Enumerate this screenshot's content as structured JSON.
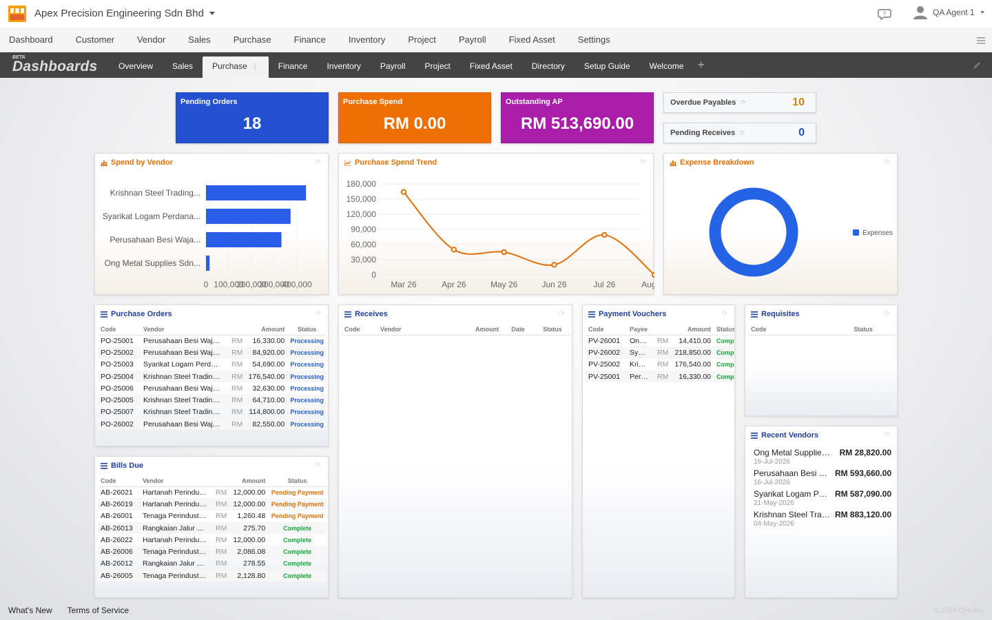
{
  "company": "Apex Precision Engineering Sdn Bhd",
  "user": "QA Agent 1",
  "main_nav": [
    "Dashboard",
    "Customer",
    "Vendor",
    "Sales",
    "Purchase",
    "Finance",
    "Inventory",
    "Project",
    "Payroll",
    "Fixed Asset",
    "Settings"
  ],
  "dashboard": {
    "beta": "BETA",
    "title": "Dashboards",
    "tabs": [
      "Overview",
      "Sales",
      "Purchase",
      "Finance",
      "Inventory",
      "Payroll",
      "Project",
      "Fixed Asset",
      "Directory",
      "Setup Guide",
      "Welcome"
    ],
    "active_tab": "Purchase",
    "add": "+"
  },
  "kpis": {
    "pending_orders": {
      "label": "Pending Orders",
      "value": "18",
      "color": "#2250cf"
    },
    "purchase_spend": {
      "label": "Purchase Spend",
      "value": "RM 0.00",
      "color": "#ee7004"
    },
    "outstanding_ap": {
      "label": "Outstanding AP",
      "value": "RM 513,690.00",
      "color": "#a81ea8"
    },
    "overdue_payables": {
      "label": "Overdue Payables",
      "value": "10",
      "color": "#c98a00"
    },
    "pending_receives": {
      "label": "Pending Receives",
      "value": "0",
      "color": "#2250cf"
    }
  },
  "panels": {
    "spend_by_vendor": "Spend by Vendor",
    "purchase_spend_trend": "Purchase Spend Trend",
    "expense_breakdown": "Expense Breakdown",
    "purchase_orders": "Purchase Orders",
    "receives": "Receives",
    "payment_vouchers": "Payment Vouchers",
    "requisites": "Requisites",
    "bills_due": "Bills Due",
    "recent_vendors": "Recent Vendors"
  },
  "chart_data": [
    {
      "type": "bar",
      "orientation": "horizontal",
      "title": "Spend by Vendor",
      "categories": [
        "Krishnan Steel Trading...",
        "Syarikat Logam Perdana...",
        "Perusahaan Besi Waja...",
        "Ong Metal Supplies Sdn..."
      ],
      "values": [
        440000,
        372000,
        332000,
        16000
      ],
      "xticks": [
        "0",
        "100,000",
        "200,000",
        "300,000",
        "400,000"
      ],
      "xlim": [
        0,
        500000
      ]
    },
    {
      "type": "line",
      "title": "Purchase Spend Trend",
      "categories": [
        "Mar 26",
        "Apr 26",
        "May 26",
        "Jun 26",
        "Jul 26",
        "Aug 26"
      ],
      "values": [
        164000,
        50000,
        45000,
        20000,
        79000,
        0
      ],
      "yticks": [
        "180,000",
        "150,000",
        "120,000",
        "90,000",
        "60,000",
        "30,000",
        "0"
      ],
      "ylim": [
        0,
        180000
      ],
      "color": "#e07006"
    },
    {
      "type": "pie",
      "style": "donut",
      "title": "Expense Breakdown",
      "labels": [
        "Expenses"
      ],
      "values": [
        100
      ],
      "color": "#2563e6"
    }
  ],
  "purchase_orders": {
    "headers": [
      "Code",
      "Vendor",
      "Amount",
      "Status"
    ],
    "rows": [
      {
        "code": "PO-25001",
        "vendor": "Perusahaan Besi Waja Sdn Bhd",
        "rm": "RM",
        "amount": "16,330.00",
        "status": "Processing"
      },
      {
        "code": "PO-25002",
        "vendor": "Perusahaan Besi Waja Sdn Bhd",
        "rm": "RM",
        "amount": "84,920.00",
        "status": "Processing"
      },
      {
        "code": "PO-25003",
        "vendor": "Syarikat Logam Perdana Sdn Bhd",
        "rm": "RM",
        "amount": "54,690.00",
        "status": "Processing"
      },
      {
        "code": "PO-25004",
        "vendor": "Krishnan Steel Trading Sdn Bhd",
        "rm": "RM",
        "amount": "176,540.00",
        "status": "Processing"
      },
      {
        "code": "PO-25006",
        "vendor": "Perusahaan Besi Waja Sdn Bhd",
        "rm": "RM",
        "amount": "32,630.00",
        "status": "Processing"
      },
      {
        "code": "PO-25005",
        "vendor": "Krishnan Steel Trading Sdn Bhd",
        "rm": "RM",
        "amount": "64,710.00",
        "status": "Processing"
      },
      {
        "code": "PO-25007",
        "vendor": "Krishnan Steel Trading Sdn Bhd",
        "rm": "RM",
        "amount": "114,800.00",
        "status": "Processing"
      },
      {
        "code": "PO-26002",
        "vendor": "Perusahaan Besi Waja Sdn Bhd",
        "rm": "RM",
        "amount": "82,550.00",
        "status": "Processing"
      }
    ]
  },
  "receives": {
    "headers": [
      "Code",
      "Vendor",
      "Amount",
      "Date",
      "Status"
    ]
  },
  "payment_vouchers": {
    "headers": [
      "Code",
      "Payee",
      "Amount",
      "Status"
    ],
    "rows": [
      {
        "code": "PV-26001",
        "payee": "Ong Metal Supplies Sdn Bhd",
        "rm": "RM",
        "amount": "14,410.00",
        "status": "Complete"
      },
      {
        "code": "PV-26002",
        "payee": "Syarikat Logam Perdana Sdn Bhd",
        "rm": "RM",
        "amount": "218,850.00",
        "status": "Complete"
      },
      {
        "code": "PV-25002",
        "payee": "Krishnan Steel Trading Sdn Bhd",
        "rm": "RM",
        "amount": "176,540.00",
        "status": "Complete"
      },
      {
        "code": "PV-25001",
        "payee": "Perusahaan Besi Waja Sdn Bhd",
        "rm": "RM",
        "amount": "16,330.00",
        "status": "Complete"
      }
    ]
  },
  "requisites": {
    "headers": [
      "Code",
      "Status"
    ]
  },
  "bills_due": {
    "headers": [
      "Code",
      "Vendor",
      "Amount",
      "Status"
    ],
    "rows": [
      {
        "code": "AB-26021",
        "vendor": "Hartanah Perindustrian Sdn Bhd",
        "rm": "RM",
        "amount": "12,000.00",
        "status": "Pending Payment"
      },
      {
        "code": "AB-26019",
        "vendor": "Hartanah Perindustrian Sdn Bhd",
        "rm": "RM",
        "amount": "12,000.00",
        "status": "Pending Payment"
      },
      {
        "code": "AB-26001",
        "vendor": "Tenaga Perindustrian Sdn Bhd",
        "rm": "RM",
        "amount": "1,260.48",
        "status": "Pending Payment"
      },
      {
        "code": "AB-26013",
        "vendor": "Rangkaian Jalur Lebar Sdn Bhd",
        "rm": "RM",
        "amount": "275.70",
        "status": "Complete"
      },
      {
        "code": "AB-26022",
        "vendor": "Hartanah Perindustrian Sdn Bhd",
        "rm": "RM",
        "amount": "12,000.00",
        "status": "Complete"
      },
      {
        "code": "AB-26006",
        "vendor": "Tenaga Perindustrian Sdn Bhd",
        "rm": "RM",
        "amount": "2,086.08",
        "status": "Complete"
      },
      {
        "code": "AB-26012",
        "vendor": "Rangkaian Jalur Lebar Sdn Bhd",
        "rm": "RM",
        "amount": "278.55",
        "status": "Complete"
      },
      {
        "code": "AB-26005",
        "vendor": "Tenaga Perindustrian Sdn Bhd",
        "rm": "RM",
        "amount": "2,128.80",
        "status": "Complete"
      }
    ]
  },
  "recent_vendors": [
    {
      "name": "Ong Metal Supplies Sdn Bhd",
      "amount": "RM 28,820.00",
      "date": "16-Jul-2026"
    },
    {
      "name": "Perusahaan Besi Waja Sdn Bhd",
      "amount": "RM 593,660.00",
      "date": "16-Jul-2026"
    },
    {
      "name": "Syarikat Logam Perdana Sdn Bhd",
      "amount": "RM 587,090.00",
      "date": "21-May-2026"
    },
    {
      "name": "Krishnan Steel Trading Sdn Bhd",
      "amount": "RM 883,120.00",
      "date": "04-May-2026"
    }
  ],
  "footer": {
    "whats_new": "What's New",
    "terms": "Terms of Service",
    "copyright": "© 2026 Cloudby"
  }
}
